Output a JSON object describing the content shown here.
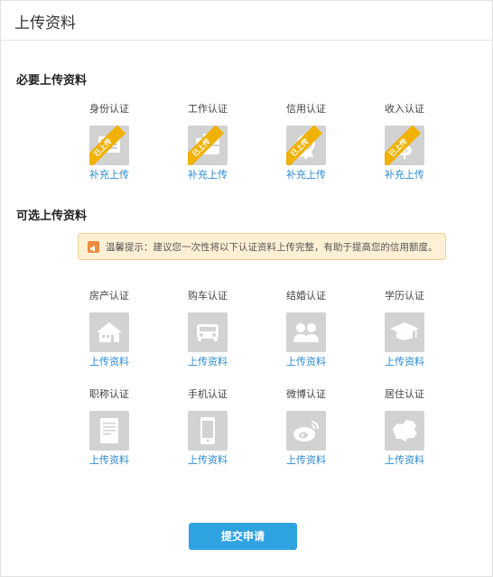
{
  "header": {
    "title": "上传资料"
  },
  "required": {
    "title": "必要上传资料",
    "items": [
      {
        "label": "身份认证",
        "badge": "已上传",
        "action": "补充上传",
        "icon": "id-card-icon"
      },
      {
        "label": "工作认证",
        "badge": "已上传",
        "action": "补充上传",
        "icon": "briefcase-icon"
      },
      {
        "label": "信用认证",
        "badge": "已上传",
        "action": "补充上传",
        "icon": "certificate-icon"
      },
      {
        "label": "收入认证",
        "badge": "已上传",
        "action": "补充上传",
        "icon": "dollar-icon"
      }
    ]
  },
  "optional": {
    "title": "可选上传资料",
    "tip": {
      "icon": "speaker-icon",
      "text": "温馨提示：建议您一次性将以下认证资料上传完整，有助于提高您的信用额度。"
    },
    "items": [
      {
        "label": "房产认证",
        "action": "上传资料",
        "icon": "house-icon"
      },
      {
        "label": "购车认证",
        "action": "上传资料",
        "icon": "car-icon"
      },
      {
        "label": "结婚认证",
        "action": "上传资料",
        "icon": "couple-icon"
      },
      {
        "label": "学历认证",
        "action": "上传资料",
        "icon": "graduation-cap-icon"
      },
      {
        "label": "职称认证",
        "action": "上传资料",
        "icon": "document-icon"
      },
      {
        "label": "手机认证",
        "action": "上传资料",
        "icon": "mobile-phone-icon"
      },
      {
        "label": "微博认证",
        "action": "上传资料",
        "icon": "weibo-icon"
      },
      {
        "label": "居住认证",
        "action": "上传资料",
        "icon": "china-map-icon"
      }
    ]
  },
  "submit": {
    "label": "提交申请"
  },
  "colors": {
    "accent": "#2fa3e0",
    "link": "#2a8ad4",
    "badge": "#f0b100",
    "tile": "#d2d2d2",
    "tip_bg": "#fdf0d5"
  }
}
